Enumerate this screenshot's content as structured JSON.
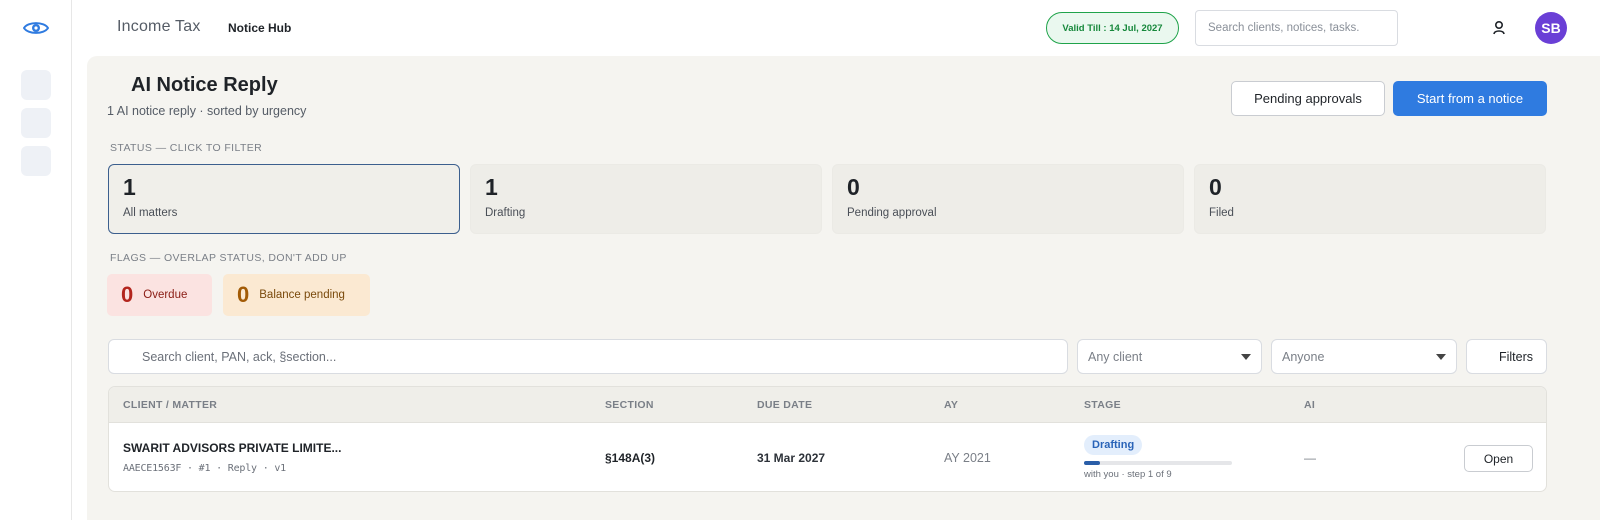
{
  "app": {
    "product_name": "Income Tax",
    "hub_name": "Notice Hub",
    "validity": "Valid Till : 14 Jul, 2027",
    "search_placeholder": "Search clients, notices, tasks.",
    "user_initials": "SB",
    "accent_color": "#2f7be0",
    "avatar_color": "#6a3fd6"
  },
  "page": {
    "title": "AI Notice Reply",
    "subtitle": "1 AI notice reply · sorted by urgency",
    "actions": {
      "pending_approvals": "Pending approvals",
      "start_from_notice": "Start from a notice"
    }
  },
  "status": {
    "label": "STATUS — CLICK TO FILTER",
    "cards": [
      {
        "count": "1",
        "label": "All matters",
        "active": true
      },
      {
        "count": "1",
        "label": "Drafting"
      },
      {
        "count": "0",
        "label": "Pending approval"
      },
      {
        "count": "0",
        "label": "Filed"
      }
    ]
  },
  "flags": {
    "label": "FLAGS — OVERLAP STATUS, DON'T ADD UP",
    "overdue": {
      "count": "0",
      "label": "Overdue"
    },
    "balance": {
      "count": "0",
      "label": "Balance pending"
    }
  },
  "filters": {
    "search_placeholder": "Search client, PAN, ack, §section...",
    "client_select": "Any client",
    "assignee_select": "Anyone",
    "filters_button": "Filters"
  },
  "table": {
    "columns": [
      "CLIENT / MATTER",
      "SECTION",
      "DUE DATE",
      "AY",
      "STAGE",
      "AI"
    ],
    "rows": [
      {
        "client": "SWARIT ADVISORS PRIVATE LIMITE...",
        "meta": "AAECE1563F · #1 · Reply · v1",
        "section": "§148A(3)",
        "due_date": "31 Mar 2027",
        "ay": "AY 2021",
        "stage": "Drafting",
        "stage_progress": 0.111,
        "stage_sub": "with you · step 1 of 9",
        "ai": "—",
        "action": "Open"
      }
    ]
  }
}
